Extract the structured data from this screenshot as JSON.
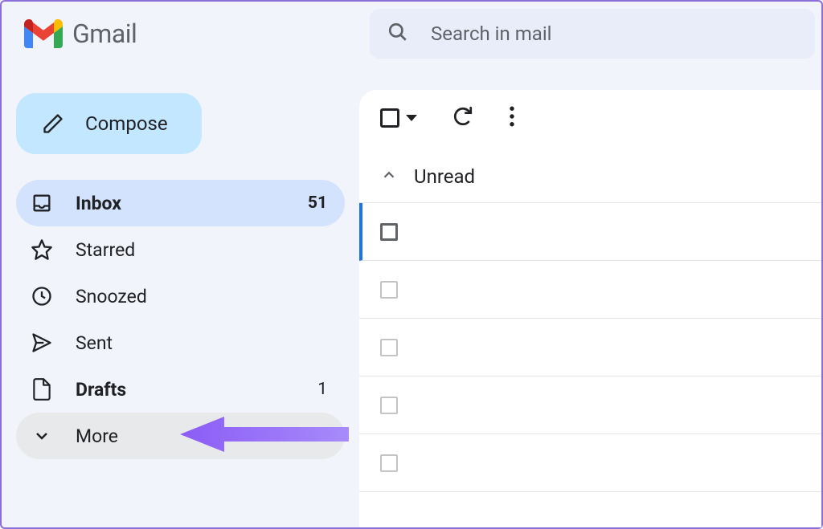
{
  "header": {
    "app_name": "Gmail",
    "search_placeholder": "Search in mail"
  },
  "compose_label": "Compose",
  "sidebar": {
    "items": [
      {
        "label": "Inbox",
        "count": "51"
      },
      {
        "label": "Starred",
        "count": ""
      },
      {
        "label": "Snoozed",
        "count": ""
      },
      {
        "label": "Sent",
        "count": ""
      },
      {
        "label": "Drafts",
        "count": "1"
      },
      {
        "label": "More",
        "count": ""
      }
    ]
  },
  "section": {
    "unread_label": "Unread"
  }
}
